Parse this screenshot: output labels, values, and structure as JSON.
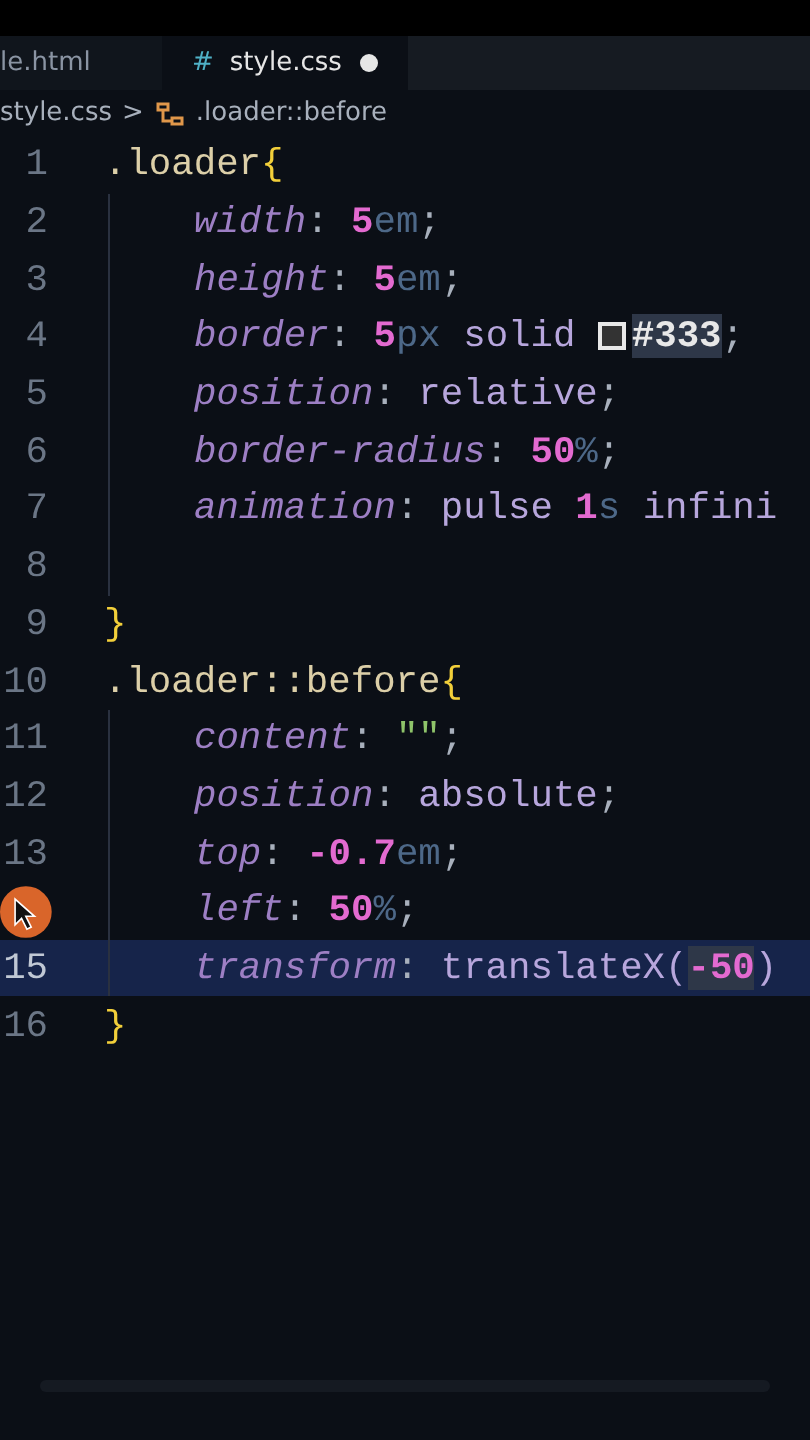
{
  "tabs": [
    {
      "label": "le.html",
      "selected": false
    },
    {
      "label": "style.css",
      "icon": "#",
      "selected": true,
      "modified": true
    }
  ],
  "breadcrumb": {
    "file": "style.css",
    "separator": ">",
    "symbol": ".loader::before"
  },
  "code": [
    {
      "number": "1",
      "tokens": [
        {
          "text": ".loader",
          "kind": "selector"
        },
        {
          "text": "{",
          "kind": "brace"
        }
      ],
      "selected": false,
      "children": [
        {
          "number": "2",
          "tokens": [
            {
              "text": "width",
              "kind": "property"
            },
            {
              "text": ": ",
              "kind": "punct"
            },
            {
              "text": "5",
              "kind": "number"
            },
            {
              "text": "em",
              "kind": "unit"
            },
            {
              "text": ";",
              "kind": "punct"
            }
          ],
          "selected": false
        },
        {
          "number": "3",
          "tokens": [
            {
              "text": "height",
              "kind": "property"
            },
            {
              "text": ": ",
              "kind": "punct"
            },
            {
              "text": "5",
              "kind": "number"
            },
            {
              "text": "em",
              "kind": "unit"
            },
            {
              "text": ";",
              "kind": "punct"
            }
          ],
          "selected": false
        },
        {
          "number": "4",
          "tokens": [
            {
              "text": "border",
              "kind": "property"
            },
            {
              "text": ": ",
              "kind": "punct"
            },
            {
              "text": "5",
              "kind": "number"
            },
            {
              "text": "px",
              "kind": "unit"
            },
            {
              "text": " solid ",
              "kind": "value"
            },
            {
              "kind": "swatch",
              "color": "#333333"
            },
            {
              "text": "#333",
              "kind": "hex",
              "highlighted": true
            },
            {
              "text": ";",
              "kind": "punct"
            }
          ],
          "selected": false
        },
        {
          "number": "5",
          "tokens": [
            {
              "text": "position",
              "kind": "property"
            },
            {
              "text": ": ",
              "kind": "punct"
            },
            {
              "text": "relative",
              "kind": "value"
            },
            {
              "text": ";",
              "kind": "punct"
            }
          ],
          "selected": false
        },
        {
          "number": "6",
          "tokens": [
            {
              "text": "border-radius",
              "kind": "property"
            },
            {
              "text": ": ",
              "kind": "punct"
            },
            {
              "text": "50",
              "kind": "number"
            },
            {
              "text": "%",
              "kind": "unit"
            },
            {
              "text": ";",
              "kind": "punct"
            }
          ],
          "selected": false
        },
        {
          "number": "7",
          "tokens": [
            {
              "text": "animation",
              "kind": "property"
            },
            {
              "text": ": ",
              "kind": "punct"
            },
            {
              "text": "pulse ",
              "kind": "value"
            },
            {
              "text": "1",
              "kind": "number"
            },
            {
              "text": "s",
              "kind": "unit"
            },
            {
              "text": " infini",
              "kind": "value"
            }
          ],
          "selected": false
        },
        {
          "number": "8",
          "selected": false
        }
      ]
    },
    {
      "number": "9",
      "tokens": [
        {
          "text": "}",
          "kind": "brace"
        }
      ],
      "selected": false
    },
    {
      "number": "10",
      "tokens": [
        {
          "text": ".loader::before",
          "kind": "selector"
        },
        {
          "text": "{",
          "kind": "brace"
        }
      ],
      "selected": false,
      "children": [
        {
          "number": "11",
          "tokens": [
            {
              "text": "content",
              "kind": "property"
            },
            {
              "text": ": ",
              "kind": "punct"
            },
            {
              "text": "\"\"",
              "kind": "string"
            },
            {
              "text": ";",
              "kind": "punct"
            }
          ],
          "selected": false
        },
        {
          "number": "12",
          "tokens": [
            {
              "text": "position",
              "kind": "property"
            },
            {
              "text": ": ",
              "kind": "punct"
            },
            {
              "text": "absolute",
              "kind": "value"
            },
            {
              "text": ";",
              "kind": "punct"
            }
          ],
          "selected": false
        },
        {
          "number": "13",
          "tokens": [
            {
              "text": "top",
              "kind": "property"
            },
            {
              "text": ": ",
              "kind": "punct"
            },
            {
              "text": "-0.7",
              "kind": "number"
            },
            {
              "text": "em",
              "kind": "unit"
            },
            {
              "text": ";",
              "kind": "punct"
            }
          ],
          "selected": false
        },
        {
          "tokens": [
            {
              "text": "left",
              "kind": "property"
            },
            {
              "text": ": ",
              "kind": "punct"
            },
            {
              "text": "50",
              "kind": "number"
            },
            {
              "text": "%",
              "kind": "unit"
            },
            {
              "text": ";",
              "kind": "punct"
            }
          ],
          "selected": false
        },
        {
          "number": "15",
          "tokens": [
            {
              "text": "transform",
              "kind": "property"
            },
            {
              "text": ": ",
              "kind": "punct"
            },
            {
              "text": "translateX(",
              "kind": "value"
            },
            {
              "text": "-50",
              "kind": "number",
              "highlighted": true
            },
            {
              "text": ")",
              "kind": "value"
            }
          ],
          "selected": true
        }
      ]
    },
    {
      "number": "16",
      "tokens": [
        {
          "text": "}",
          "kind": "brace"
        }
      ],
      "selected": false
    }
  ]
}
